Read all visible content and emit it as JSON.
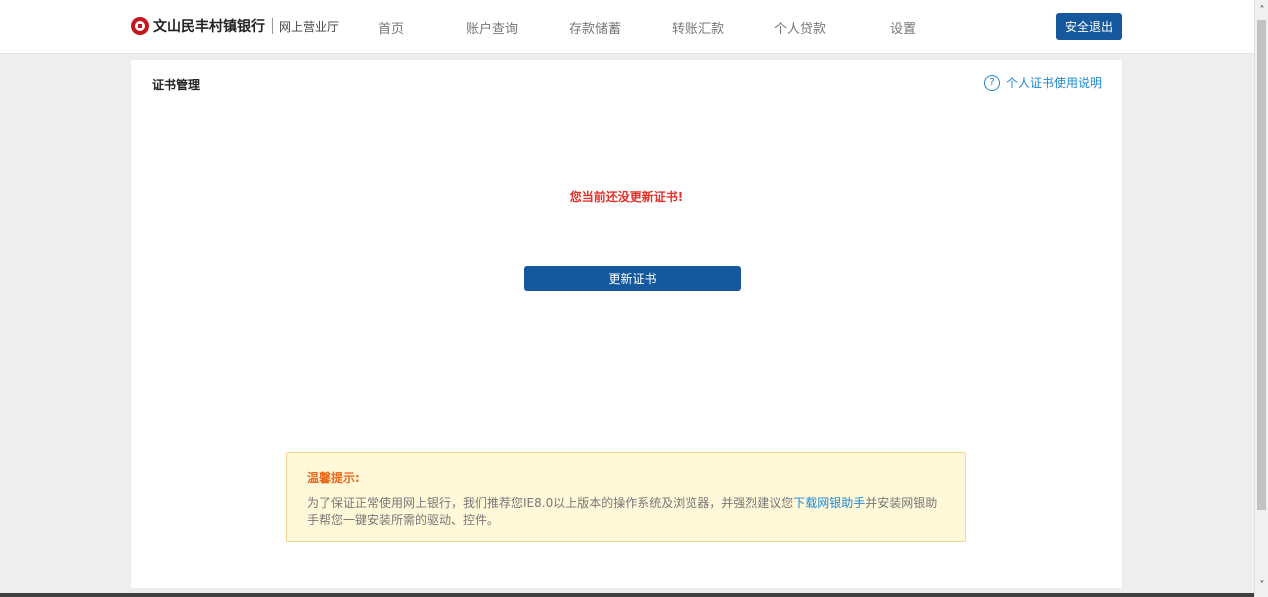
{
  "header": {
    "brand_name": "文山民丰村镇银行",
    "brand_sub": "网上营业厅",
    "nav": [
      {
        "label": "首页"
      },
      {
        "label": "账户查询"
      },
      {
        "label": "存款储蓄"
      },
      {
        "label": "转账汇款"
      },
      {
        "label": "个人贷款"
      },
      {
        "label": "设置"
      }
    ],
    "logout_label": "安全退出"
  },
  "panel": {
    "title": "证书管理",
    "help_label": "个人证书使用说明",
    "help_icon_glyph": "?",
    "warning": "您当前还没更新证书!",
    "update_button_label": "更新证书"
  },
  "tips": {
    "title": "温馨提示:",
    "text_before": "为了保证正常使用网上银行，我们推荐您IE8.0以上版本的操作系统及浏览器，并强烈建议您",
    "link": "下载网银助手",
    "text_after": "并安装网银助手帮您一键安装所需的驱动、控件。"
  },
  "colors": {
    "primary": "#15589e",
    "warning_text": "#e2322b",
    "tips_title": "#ea6a1c",
    "link": "#1e88d6",
    "tips_bg": "#fff8d9"
  }
}
